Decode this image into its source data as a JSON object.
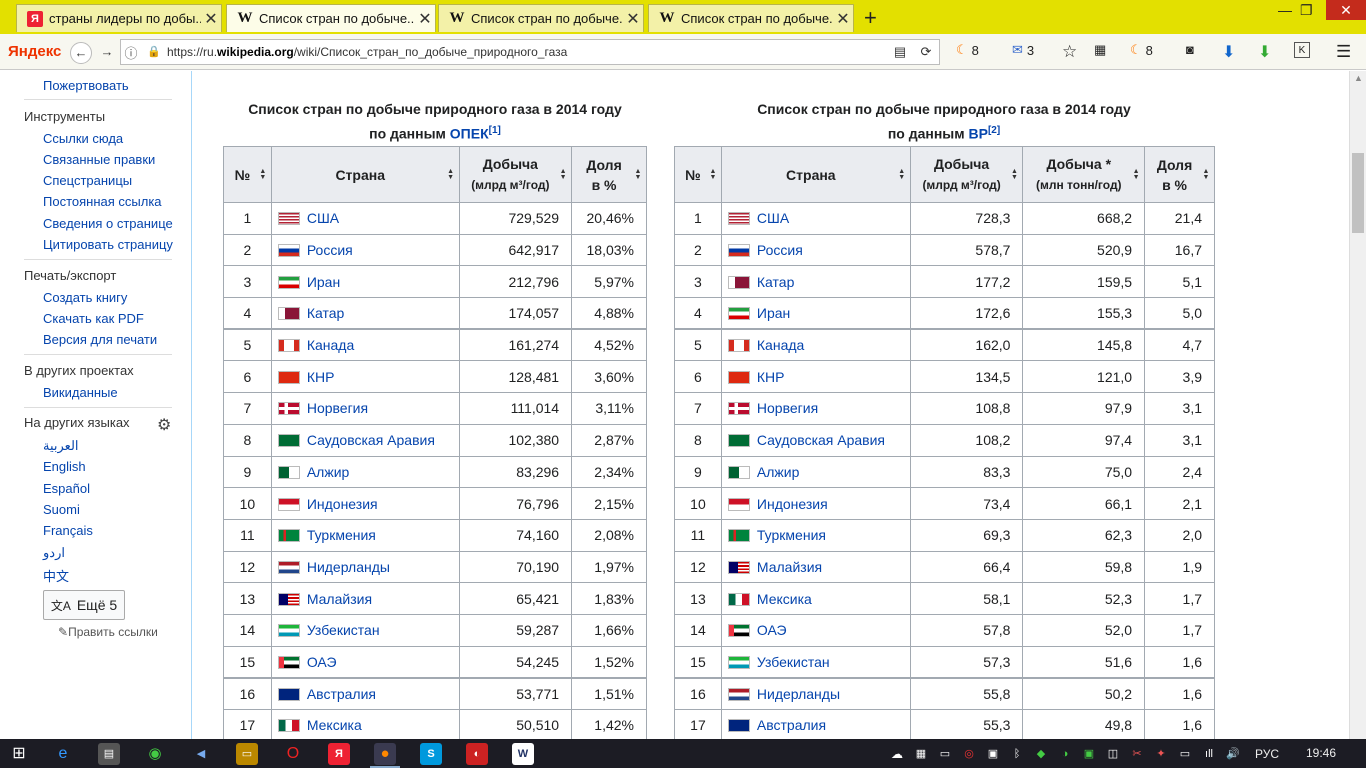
{
  "tabs": [
    {
      "favicon": "yandex-icon",
      "title": "страны лидеры по добы...",
      "active": false
    },
    {
      "favicon": "wikipedia-icon",
      "title": "Список стран по добыче...",
      "active": true
    },
    {
      "favicon": "wikipedia-icon",
      "title": "Список стран по добыче...",
      "active": false
    },
    {
      "favicon": "wikipedia-icon",
      "title": "Список стран по добыче...",
      "active": false
    }
  ],
  "browser": {
    "logo": "Яндекс",
    "url_prefix": "https://ru.",
    "url_host": "wikipedia.org",
    "url_path": "/wiki/Список_стран_по_добыче_природного_газа",
    "badge_a": "8",
    "badge_mail": "3",
    "badge_b": "8"
  },
  "sidebar": {
    "donate": "Пожертвовать",
    "tools_heading": "Инструменты",
    "tools": [
      "Ссылки сюда",
      "Связанные правки",
      "Спецстраницы",
      "Постоянная ссылка",
      "Сведения о странице",
      "Цитировать страницу"
    ],
    "print_heading": "Печать/экспорт",
    "print": [
      "Создать книгу",
      "Скачать как PDF",
      "Версия для печати"
    ],
    "projects_heading": "В других проектах",
    "projects": [
      "Викиданные"
    ],
    "langs_heading": "На других языках",
    "langs": [
      "العربية",
      "English",
      "Español",
      "Suomi",
      "Français",
      "اردو",
      "中文"
    ],
    "more_langs": "Ещё 5",
    "edit_links": "Править ссылки"
  },
  "opec": {
    "caption_line1": "Список стран по добыче природного газа в 2014 году",
    "caption_prefix": "по данным ",
    "caption_source": "ОПЕК",
    "caption_ref": "[1]",
    "headers": {
      "num": "№",
      "country": "Страна",
      "prod": "Добыча",
      "prod_unit": "(млрд м³/год)",
      "share": "Доля",
      "share_unit": "в %"
    },
    "rows": [
      {
        "n": "1",
        "country": "США",
        "flag": "us",
        "prod": "729,529",
        "share": "20,46%"
      },
      {
        "n": "2",
        "country": "Россия",
        "flag": "ru",
        "prod": "642,917",
        "share": "18,03%"
      },
      {
        "n": "3",
        "country": "Иран",
        "flag": "ir",
        "prod": "212,796",
        "share": "5,97%"
      },
      {
        "n": "4",
        "country": "Катар",
        "flag": "qa",
        "prod": "174,057",
        "share": "4,88%"
      },
      {
        "n": "5",
        "country": "Канада",
        "flag": "ca",
        "prod": "161,274",
        "share": "4,52%"
      },
      {
        "n": "6",
        "country": "КНР",
        "flag": "cn",
        "prod": "128,481",
        "share": "3,60%"
      },
      {
        "n": "7",
        "country": "Норвегия",
        "flag": "no",
        "prod": "111,014",
        "share": "3,11%"
      },
      {
        "n": "8",
        "country": "Саудовская Аравия",
        "flag": "sa",
        "prod": "102,380",
        "share": "2,87%"
      },
      {
        "n": "9",
        "country": "Алжир",
        "flag": "dz",
        "prod": "83,296",
        "share": "2,34%"
      },
      {
        "n": "10",
        "country": "Индонезия",
        "flag": "id",
        "prod": "76,796",
        "share": "2,15%"
      },
      {
        "n": "11",
        "country": "Туркмения",
        "flag": "tm",
        "prod": "74,160",
        "share": "2,08%"
      },
      {
        "n": "12",
        "country": "Нидерланды",
        "flag": "nl",
        "prod": "70,190",
        "share": "1,97%"
      },
      {
        "n": "13",
        "country": "Малайзия",
        "flag": "my",
        "prod": "65,421",
        "share": "1,83%"
      },
      {
        "n": "14",
        "country": "Узбекистан",
        "flag": "uz",
        "prod": "59,287",
        "share": "1,66%"
      },
      {
        "n": "15",
        "country": "ОАЭ",
        "flag": "ae",
        "prod": "54,245",
        "share": "1,52%"
      },
      {
        "n": "16",
        "country": "Австралия",
        "flag": "au",
        "prod": "53,771",
        "share": "1,51%"
      },
      {
        "n": "17",
        "country": "Мексика",
        "flag": "mx",
        "prod": "50,510",
        "share": "1,42%"
      }
    ]
  },
  "bp": {
    "caption_line1": "Список стран по добыче природного газа в 2014 году",
    "caption_prefix": "по данным ",
    "caption_source": "BP",
    "caption_ref": "[2]",
    "headers": {
      "num": "№",
      "country": "Страна",
      "prod": "Добыча",
      "prod_unit": "(млрд м³/год)",
      "prod2": "Добыча *",
      "prod2_unit": "(млн тонн/год)",
      "share": "Доля",
      "share_unit": "в %"
    },
    "rows": [
      {
        "n": "1",
        "country": "США",
        "flag": "us",
        "prod": "728,3",
        "prod2": "668,2",
        "share": "21,4"
      },
      {
        "n": "2",
        "country": "Россия",
        "flag": "ru",
        "prod": "578,7",
        "prod2": "520,9",
        "share": "16,7"
      },
      {
        "n": "3",
        "country": "Катар",
        "flag": "qa",
        "prod": "177,2",
        "prod2": "159,5",
        "share": "5,1"
      },
      {
        "n": "4",
        "country": "Иран",
        "flag": "ir",
        "prod": "172,6",
        "prod2": "155,3",
        "share": "5,0"
      },
      {
        "n": "5",
        "country": "Канада",
        "flag": "ca",
        "prod": "162,0",
        "prod2": "145,8",
        "share": "4,7"
      },
      {
        "n": "6",
        "country": "КНР",
        "flag": "cn",
        "prod": "134,5",
        "prod2": "121,0",
        "share": "3,9"
      },
      {
        "n": "7",
        "country": "Норвегия",
        "flag": "no",
        "prod": "108,8",
        "prod2": "97,9",
        "share": "3,1"
      },
      {
        "n": "8",
        "country": "Саудовская Аравия",
        "flag": "sa",
        "prod": "108,2",
        "prod2": "97,4",
        "share": "3,1"
      },
      {
        "n": "9",
        "country": "Алжир",
        "flag": "dz",
        "prod": "83,3",
        "prod2": "75,0",
        "share": "2,4"
      },
      {
        "n": "10",
        "country": "Индонезия",
        "flag": "id",
        "prod": "73,4",
        "prod2": "66,1",
        "share": "2,1"
      },
      {
        "n": "11",
        "country": "Туркмения",
        "flag": "tm",
        "prod": "69,3",
        "prod2": "62,3",
        "share": "2,0"
      },
      {
        "n": "12",
        "country": "Малайзия",
        "flag": "my",
        "prod": "66,4",
        "prod2": "59,8",
        "share": "1,9"
      },
      {
        "n": "13",
        "country": "Мексика",
        "flag": "mx",
        "prod": "58,1",
        "prod2": "52,3",
        "share": "1,7"
      },
      {
        "n": "14",
        "country": "ОАЭ",
        "flag": "ae",
        "prod": "57,8",
        "prod2": "52,0",
        "share": "1,7"
      },
      {
        "n": "15",
        "country": "Узбекистан",
        "flag": "uz",
        "prod": "57,3",
        "prod2": "51,6",
        "share": "1,6"
      },
      {
        "n": "16",
        "country": "Нидерланды",
        "flag": "nl",
        "prod": "55,8",
        "prod2": "50,2",
        "share": "1,6"
      },
      {
        "n": "17",
        "country": "Австралия",
        "flag": "au",
        "prod": "55,3",
        "prod2": "49,8",
        "share": "1,6"
      }
    ]
  },
  "taskbar": {
    "lang": "РУС",
    "time": "19:46"
  }
}
